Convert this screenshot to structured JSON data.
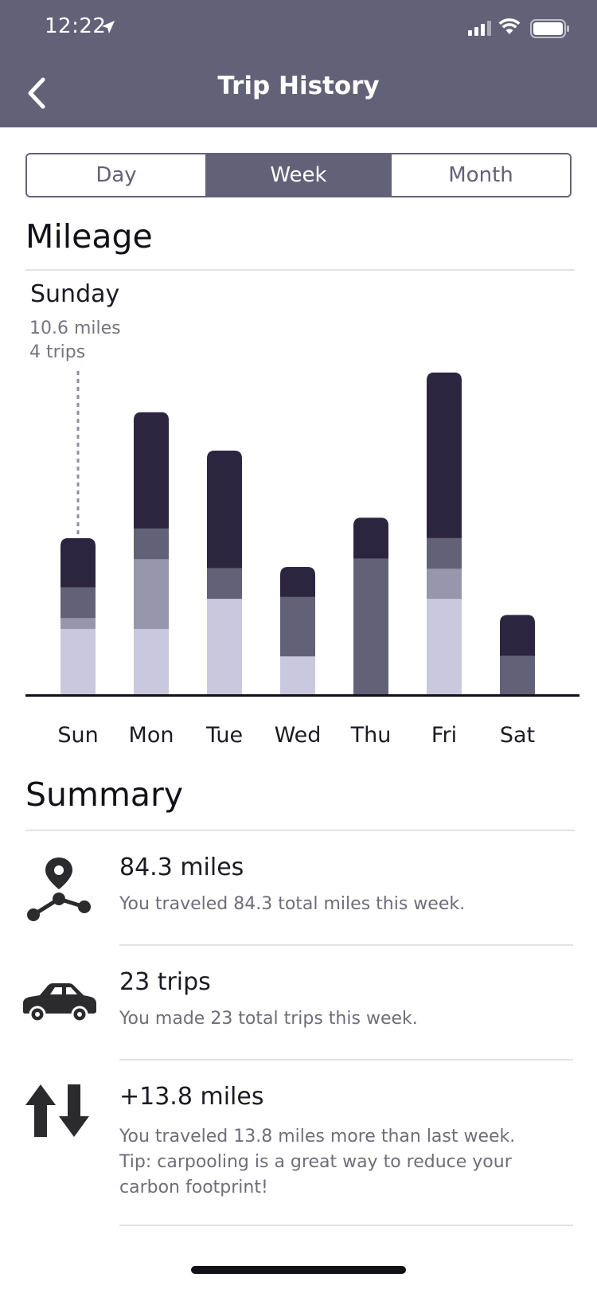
{
  "status_bar": {
    "time": "12:22"
  },
  "header": {
    "title": "Trip History"
  },
  "segments": [
    {
      "label": "Day",
      "selected": false
    },
    {
      "label": "Week",
      "selected": true
    },
    {
      "label": "Month",
      "selected": false
    }
  ],
  "mileage": {
    "title": "Mileage",
    "selected": {
      "day": "Sunday",
      "miles_text": "10.6 miles",
      "trips_text": "4 trips"
    }
  },
  "chart_data": {
    "type": "bar",
    "stacked": true,
    "categories": [
      "Sun",
      "Mon",
      "Tue",
      "Wed",
      "Thu",
      "Fri",
      "Sat"
    ],
    "series": [
      {
        "values": [
          4.8,
          4.8,
          7.0,
          2.8,
          0,
          7.0,
          0
        ],
        "color": "#c9c8de"
      },
      {
        "values": [
          0.8,
          5.1,
          0,
          0,
          0,
          2.2,
          0
        ],
        "color": "#9896ad"
      },
      {
        "values": [
          2.2,
          2.2,
          2.2,
          4.3,
          9.9,
          2.2,
          2.8
        ],
        "color": "#636178"
      },
      {
        "values": [
          3.6,
          8.5,
          8.6,
          2.2,
          3.0,
          12.1,
          3.0
        ],
        "color": "#2c2540"
      }
    ],
    "ylim": [
      0,
      26
    ],
    "grid": false,
    "highlighted_category": "Sun"
  },
  "summary": {
    "title": "Summary",
    "items": [
      {
        "icon": "route-pin-icon",
        "title": "84.3 miles",
        "desc": "You traveled 84.3 total miles this week."
      },
      {
        "icon": "car-icon",
        "title": "23 trips",
        "desc": "You made 23 total trips this week."
      },
      {
        "icon": "up-down-arrows-icon",
        "title": "+13.8 miles",
        "desc": "You traveled 13.8 miles more than last week. Tip: carpooling is a great way to reduce your carbon footprint!"
      }
    ]
  },
  "colors": {
    "header": "#636178",
    "accent_dark": "#2c2540",
    "icon": "#2b2b2e"
  }
}
